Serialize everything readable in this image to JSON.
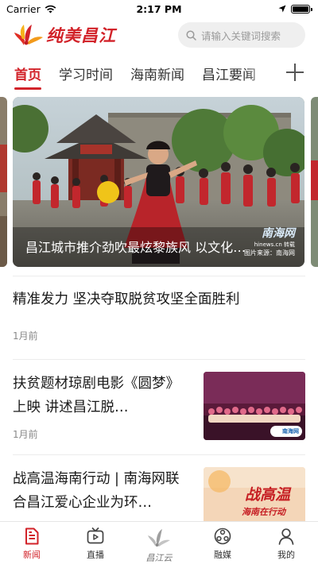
{
  "status_bar": {
    "carrier": "Carrier",
    "time": "2:17 PM",
    "battery_level": 1.0
  },
  "header": {
    "logo_text": "纯美昌江",
    "search": {
      "placeholder": "请输入关键词搜索"
    }
  },
  "tabs": {
    "items": [
      {
        "label": "首页",
        "active": true
      },
      {
        "label": "学习时间",
        "active": false
      },
      {
        "label": "海南新闻",
        "active": false
      },
      {
        "label": "昌江要闻",
        "active": false
      }
    ],
    "add_icon": "plus-icon"
  },
  "carousel": {
    "caption": "昌江城市推介劲吹最炫黎族风 以文化…",
    "watermark": {
      "name": "南海网",
      "site": "hinews.cn",
      "tag": "转载",
      "credit": "图片来源：南海网"
    }
  },
  "articles": [
    {
      "title": "精准发力 坚决夺取脱贫攻坚全面胜利",
      "time": "1月前",
      "has_thumb": false
    },
    {
      "title": "扶贫题材琼剧电影《圆梦》上映 讲述昌江脱…",
      "time": "1月前",
      "has_thumb": true,
      "thumb_badge": "南海网"
    },
    {
      "title": "战高温海南行动 | 南海网联合昌江爱心企业为环…",
      "time": "",
      "has_thumb": true,
      "thumb_text_1": "战高温",
      "thumb_text_2": "海南在行动"
    }
  ],
  "bottom_nav": {
    "items": [
      {
        "label": "新闻",
        "icon": "news-icon",
        "active": true
      },
      {
        "label": "直播",
        "icon": "live-tv-icon",
        "active": false
      },
      {
        "label": "昌江云",
        "icon": "changjiang-cloud-logo-icon",
        "active": false
      },
      {
        "label": "融媒",
        "icon": "media-hub-icon",
        "active": false
      },
      {
        "label": "我的",
        "icon": "profile-icon",
        "active": false
      }
    ]
  },
  "colors": {
    "accent": "#d2232a",
    "text": "#1a1a1a",
    "muted": "#888888",
    "search_bg": "#efefef"
  }
}
